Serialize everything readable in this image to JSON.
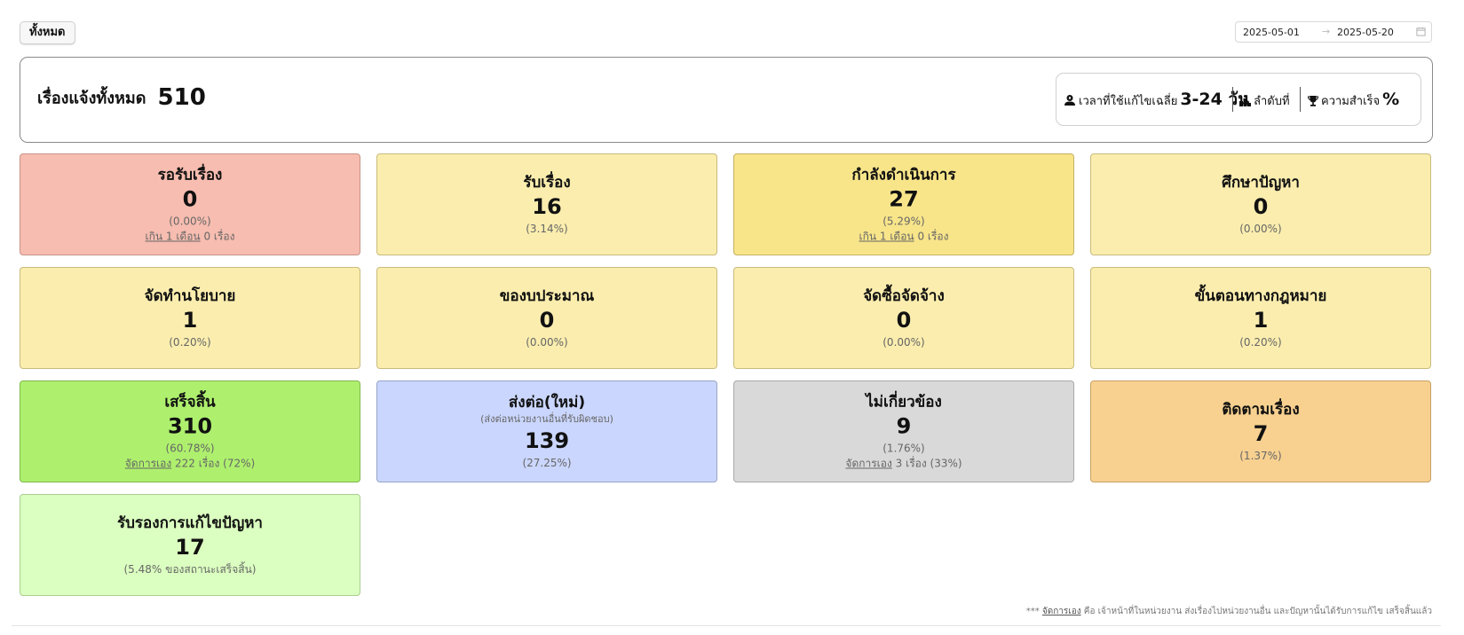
{
  "filter": {
    "all_label": "ทั้งหมด",
    "date_from": "2025-05-01",
    "date_to": "2025-05-20"
  },
  "summary": {
    "total_label": "เรื่องแจ้งทั้งหมด",
    "total_value": "510",
    "avg_time_label": "เวลาที่ใช้แก้ไขเฉลี่ย",
    "avg_time_value": "3-24 วัน",
    "rank_label": "ลำดับที่",
    "rank_value": "",
    "success_label": "ความสำเร็จ",
    "success_value": "%"
  },
  "cards": [
    {
      "title": "รอรับเรื่อง",
      "value": "0",
      "pct": "(0.00%)",
      "extra_link": "เกิน 1 เดือน",
      "extra_text": " 0 เรื่อง",
      "color": "#f7bdb0"
    },
    {
      "title": "รับเรื่อง",
      "value": "16",
      "pct": "(3.14%)",
      "color": "#faedae"
    },
    {
      "title": "กำลังดำเนินการ",
      "value": "27",
      "pct": "(5.29%)",
      "extra_link": "เกิน 1 เดือน",
      "extra_text": " 0 เรื่อง",
      "color": "#f8e58a"
    },
    {
      "title": "ศึกษาปัญหา",
      "value": "0",
      "pct": "(0.00%)",
      "color": "#faedae"
    },
    {
      "title": "จัดทำนโยบาย",
      "value": "1",
      "pct": "(0.20%)",
      "color": "#faedae"
    },
    {
      "title": "ของบประมาณ",
      "value": "0",
      "pct": "(0.00%)",
      "color": "#faedae"
    },
    {
      "title": "จัดซื้อจัดจ้าง",
      "value": "0",
      "pct": "(0.00%)",
      "color": "#faedae"
    },
    {
      "title": "ขั้นตอนทางกฎหมาย",
      "value": "1",
      "pct": "(0.20%)",
      "color": "#faedae"
    },
    {
      "title": "เสร็จสิ้น",
      "value": "310",
      "pct": "(60.78%)",
      "extra_link": "จัดการเอง",
      "extra_text": " 222 เรื่อง (72%)",
      "color": "#aef06e"
    },
    {
      "title": "ส่งต่อ(ใหม่)",
      "subtitle": "(ส่งต่อหน่วยงานอื่นที่รับผิดชอบ)",
      "value": "139",
      "pct": "(27.25%)",
      "color": "#cad6fd"
    },
    {
      "title": "ไม่เกี่ยวข้อง",
      "value": "9",
      "pct": "(1.76%)",
      "extra_link": "จัดการเอง",
      "extra_text": " 3 เรื่อง (33%)",
      "color": "#d9d9d9"
    },
    {
      "title": "ติดตามเรื่อง",
      "value": "7",
      "pct": "(1.37%)",
      "color": "#f8d190"
    },
    {
      "title": "รับรองการแก้ไขปัญหา",
      "value": "17",
      "pct": "(5.48% ของสถานะเสร็จสิ้น)",
      "color": "#dbffc0"
    }
  ],
  "footnote": {
    "prefix": "*** ",
    "link": "จัดการเอง",
    "text": " คือ เจ้าหน้าที่ในหน่วยงาน ส่งเรื่องไปหน่วยงานอื่น และปัญหานั้นได้รับการแก้ไข เสร็จสิ้นแล้ว"
  }
}
